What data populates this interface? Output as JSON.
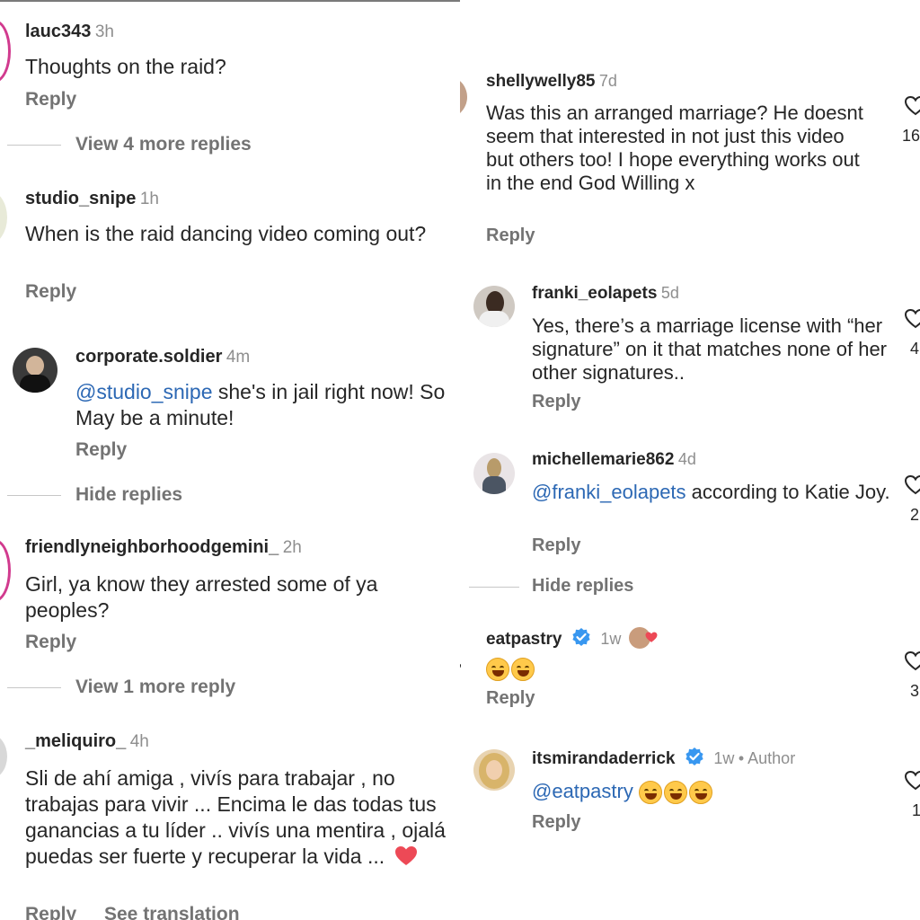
{
  "left": {
    "comments": [
      {
        "user": "lauc343",
        "time": "3h",
        "text": "Thoughts on the raid?",
        "reply": "Reply",
        "view_more": "View 4 more replies"
      },
      {
        "user": "studio_snipe",
        "time": "1h",
        "text": "When is the raid dancing video coming out?",
        "reply": "Reply"
      },
      {
        "user": "corporate.soldier",
        "time": "4m",
        "mention": "@studio_snipe",
        "text": " she's in jail right now! So May be a minute!",
        "reply": "Reply",
        "hide": "Hide replies"
      },
      {
        "user": "friendlyneighborhoodgemini_",
        "time": "2h",
        "text": "Girl, ya know they arrested some of ya peoples?",
        "reply": "Reply",
        "view_more": "View 1 more reply"
      },
      {
        "user": "_meliquiro_",
        "time": "4h",
        "text": "Sli de  ahí amiga , vivís para trabajar , no trabajas para vivir ... Encima le das todas tus ganancias a tu líder .. vivís una mentira , ojalá puedas ser fuerte y recuperar la vida ...",
        "reply": "Reply",
        "see_translation": "See translation"
      }
    ]
  },
  "right": {
    "comments": [
      {
        "user": "shellywelly85",
        "time": "7d",
        "text": "Was this an arranged marriage? He doesnt seem that interested in not just this video but others too! I hope everything works out in the end God Willing x",
        "reply": "Reply",
        "likes": "16"
      },
      {
        "user": "franki_eolapets",
        "time": "5d",
        "text": "Yes, there’s a marriage license with “her signature” on it that matches none of her other signatures..",
        "reply": "Reply",
        "likes": "4"
      },
      {
        "user": "michellemarie862",
        "time": "4d",
        "mention": "@franki_eolapets",
        "text": " according to Katie Joy.",
        "reply": "Reply",
        "hide": "Hide replies",
        "likes": "2"
      },
      {
        "user": "eatpastry",
        "time": "1w",
        "reply": "Reply",
        "likes": "3"
      },
      {
        "user": "itsmirandaderrick",
        "time": "1w",
        "author": "• Author",
        "mention": "@eatpastry",
        "reply": "Reply",
        "likes": "1"
      }
    ]
  },
  "colors": {
    "mention": "#2c68b4",
    "verified": "#3897f0",
    "heart": "#ed4956",
    "ring": "#d13a8e"
  },
  "icons": [
    "heart-outline-icon",
    "verified-badge-icon",
    "red-heart-icon",
    "laughing-emoji-icon"
  ]
}
